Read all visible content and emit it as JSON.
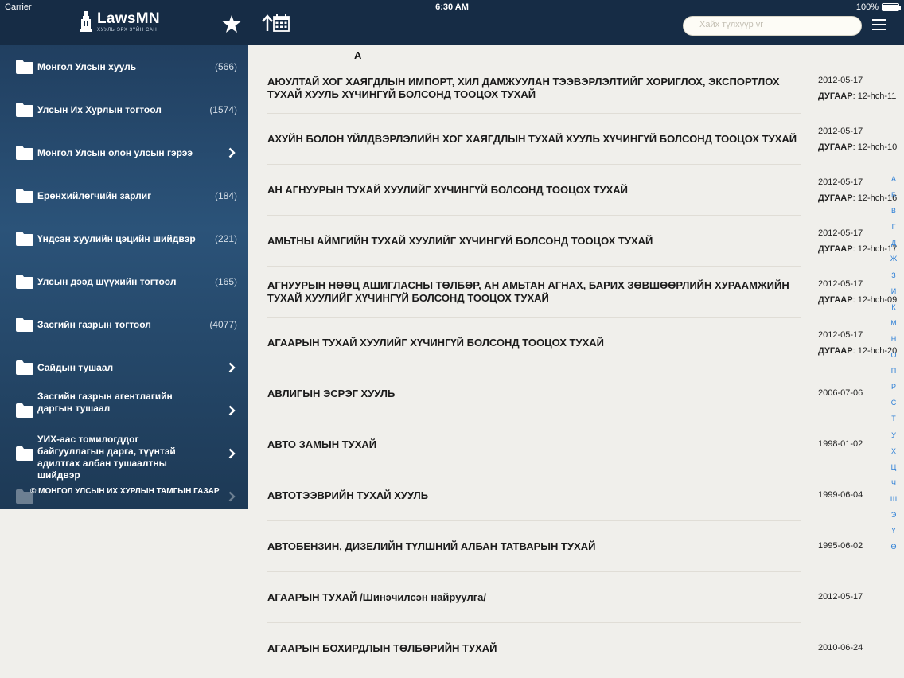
{
  "status_bar": {
    "carrier": "Carrier",
    "time": "6:30 AM",
    "battery": "100%"
  },
  "app": {
    "title": "LawsMN",
    "subtitle": "ХУУЛЬ ЭРХ ЗҮЙН САН"
  },
  "sidebar": {
    "items": [
      {
        "label": "Монгол Улсын хууль",
        "count": "(566)"
      },
      {
        "label": "Улсын Их Хурлын тогтоол",
        "count": "(1574)"
      },
      {
        "label": "Монгол Улсын олон улсын гэрээ",
        "count": ""
      },
      {
        "label": "Ерөнхийлөгчийн зарлиг",
        "count": "(184)"
      },
      {
        "label": "Үндсэн хуулийн цэцийн шийдвэр",
        "count": "(221)"
      },
      {
        "label": "Улсын дээд шүүхийн тогтоол",
        "count": "(165)"
      },
      {
        "label": "Засгийн газрын тогтоол",
        "count": "(4077)"
      },
      {
        "label": "Сайдын тушаал",
        "count": ""
      },
      {
        "label": "Засгийн газрын агентлагийн даргын тушаал",
        "count": ""
      },
      {
        "label": "УИХ-аас томилогддог байгууллагын дарга, түүнтэй адилтгах албан тушаалтны шийдвэр",
        "count": ""
      },
      {
        "label": "",
        "count": ""
      }
    ],
    "footer": "© МОНГОЛ УЛСЫН ИХ ХУРЛЫН ТАМГЫН ГАЗАР"
  },
  "search": {
    "placeholder": "Хайх түлхүүр үг"
  },
  "section_letter": "А",
  "laws": [
    {
      "title": "АЮУЛТАЙ ХОГ ХАЯГДЛЫН ИМПОРТ,   ХИЛ ДАМЖУУЛАН ТЭЭВЭРЛЭЛТИЙГ  ХОРИГЛОХ, ЭКСПОРТЛОХ ТУХАЙ ХУУЛЬ ХҮЧИНГҮЙ БОЛСОНД  ТООЦОХ ТУХАЙ",
      "date": "2012-05-17",
      "number_label": "ДУГААР",
      "number": ": 12-hch-11"
    },
    {
      "title": "АХУЙН БОЛОН ҮЙЛДВЭРЛЭЛИЙН  ХОГ ХАЯГДЛЫН ТУХАЙ ХУУЛЬ ХҮЧИНГҮЙ БОЛСОНД ТООЦОХ ТУХАЙ",
      "date": "2012-05-17",
      "number_label": "ДУГААР",
      "number": ": 12-hch-10"
    },
    {
      "title": "АН АГНУУРЫН ТУХАЙ ХУУЛИЙГ   ХҮЧИНГҮЙ БОЛСОНД ТООЦОХ ТУХАЙ",
      "date": "2012-05-17",
      "number_label": "ДУГААР",
      "number": ": 12-hch-16"
    },
    {
      "title": "АМЬТНЫ АЙМГИЙН ТУХАЙ ХУУЛИЙГ     ХҮЧИНГҮЙ БОЛСОНД ТООЦОХ ТУХАЙ",
      "date": "2012-05-17",
      "number_label": "ДУГААР",
      "number": ": 12-hch-17"
    },
    {
      "title": "АГНУУРЫН НӨӨЦ АШИГЛАСНЫ ТӨЛБӨР,  АН АМЬТАН АГНАХ, БАРИХ ЗӨВШӨӨРЛИЙН  ХУРААМЖИЙН ТУХАЙ ХУУЛИЙГ ХҮЧИНГҮЙ  БОЛСОНД ТООЦОХ ТУХАЙ",
      "date": "2012-05-17",
      "number_label": "ДУГААР",
      "number": ": 12-hch-09"
    },
    {
      "title": "АГААРЫН ТУХАЙ ХУУЛИЙГ ХҮЧИНГҮЙ  БОЛСОНД ТООЦОХ ТУХАЙ",
      "date": "2012-05-17",
      "number_label": "ДУГААР",
      "number": ": 12-hch-20"
    },
    {
      "title": "АВЛИГЫН ЭСРЭГ ХУУЛЬ",
      "date": "2006-07-06",
      "number_label": "",
      "number": ""
    },
    {
      "title": "АВТО ЗАМЫН ТУХАЙ",
      "date": "1998-01-02",
      "number_label": "",
      "number": ""
    },
    {
      "title": "АВТОТЭЭВРИЙН ТУХАЙ ХУУЛЬ",
      "date": "1999-06-04",
      "number_label": "",
      "number": ""
    },
    {
      "title": "АВТОБЕНЗИН, ДИЗЕЛИЙН ТҮЛШНИЙ АЛБАН ТАТВАРЫН ТУХАЙ",
      "date": "1995-06-02",
      "number_label": "",
      "number": ""
    },
    {
      "title": "АГААРЫН ТУХАЙ /Шинэчилсэн найруулга/",
      "date": "2012-05-17",
      "number_label": "",
      "number": ""
    },
    {
      "title": "АГААРЫН БОХИРДЛЫН ТӨЛБӨРИЙН ТУХАЙ",
      "date": "2010-06-24",
      "number_label": "",
      "number": ""
    }
  ],
  "alphabet": [
    "А",
    "Б",
    "В",
    "Г",
    "Д",
    "Ж",
    "З",
    "И",
    "К",
    "М",
    "Н",
    "О",
    "П",
    "Р",
    "С",
    "Т",
    "У",
    "Х",
    "Ц",
    "Ч",
    "Ш",
    "Э",
    "Ү",
    "Ө"
  ],
  "colors": {
    "header": "#162c45",
    "sidebar": "#2b5379",
    "index_link": "#2d7fd6",
    "background": "#f0efeb"
  }
}
